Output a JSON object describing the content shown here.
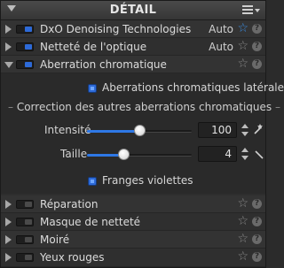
{
  "header": {
    "title": "DÉTAIL",
    "menu_icon": "hamburger-menu-icon",
    "collapse_icon": "triangle-down-icon"
  },
  "colors": {
    "accent": "#2e78e6",
    "star_active": "#3b8de0",
    "background": "#2e2e2e"
  },
  "rows_top": [
    {
      "label": "DxO Denoising Technologies",
      "preset": "Auto",
      "star_active": true,
      "expanded": false
    },
    {
      "label": "Netteté de l'optique",
      "preset": "Auto",
      "star_active": false,
      "expanded": false
    },
    {
      "label": "Aberration chromatique",
      "preset": "",
      "star_active": false,
      "expanded": true
    }
  ],
  "aberration": {
    "lateral_checkbox_label": "Aberrations chromatiques latérales",
    "lateral_checked": true,
    "subsection_title": "Correction des autres aberrations chromatiques",
    "intensity": {
      "label": "Intensité",
      "value": "100",
      "slider_fraction": 0.5,
      "tool_icon": "magic-wand-icon"
    },
    "size": {
      "label": "Taille",
      "value": "4",
      "slider_fraction": 0.35,
      "tool_icon": "eyedropper-icon"
    },
    "purple_fringes_label": "Franges violettes",
    "purple_fringes_checked": true
  },
  "rows_bottom": [
    {
      "label": "Réparation",
      "star_active": false
    },
    {
      "label": "Masque de netteté",
      "star_active": false
    },
    {
      "label": "Moiré",
      "star_active": false
    },
    {
      "label": "Yeux rouges",
      "star_active": false
    }
  ],
  "icons": {
    "star": "☆",
    "help": "?"
  }
}
